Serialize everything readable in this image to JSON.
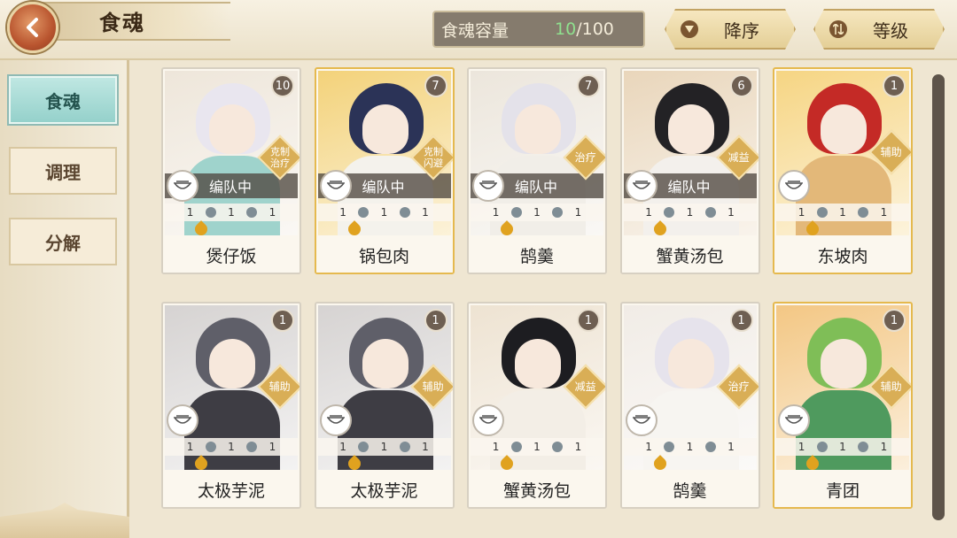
{
  "header": {
    "title": "食魂",
    "capacity_label": "食魂容量",
    "capacity_current": "10",
    "capacity_max": "/100",
    "sort_order_label": "降序",
    "sort_level_label": "等级"
  },
  "sidebar": {
    "tabs": [
      {
        "label": "食魂"
      },
      {
        "label": "调理"
      },
      {
        "label": "分解"
      }
    ]
  },
  "team_label": "编队中",
  "skill_value": "1",
  "cards": [
    {
      "name": "煲仔饭",
      "count": "10",
      "role": "克制\n治疗",
      "in_team": true
    },
    {
      "name": "锅包肉",
      "count": "7",
      "role": "克制\n闪避",
      "in_team": true
    },
    {
      "name": "鹄羹",
      "count": "7",
      "role": "治疗",
      "in_team": true
    },
    {
      "name": "蟹黄汤包",
      "count": "6",
      "role": "减益",
      "in_team": true
    },
    {
      "name": "东坡肉",
      "count": "1",
      "role": "辅助",
      "in_team": false
    },
    {
      "name": "太极芋泥",
      "count": "1",
      "role": "辅助",
      "in_team": false
    },
    {
      "name": "太极芋泥",
      "count": "1",
      "role": "辅助",
      "in_team": false
    },
    {
      "name": "蟹黄汤包",
      "count": "1",
      "role": "减益",
      "in_team": false
    },
    {
      "name": "鹄羹",
      "count": "1",
      "role": "治疗",
      "in_team": false
    },
    {
      "name": "青团",
      "count": "1",
      "role": "辅助",
      "in_team": false
    }
  ],
  "colors": {
    "active_tab": "#95d1cb",
    "role_badge": "#d9ae56",
    "card_gold_border": "#e5b94e",
    "capacity_value": "#8fe08e"
  },
  "icons": {
    "back": "back-arrow-icon",
    "sort_order": "triangle-down-icon",
    "sort_level": "sort-arrows-icon",
    "team": "bowl-icon",
    "skill": "skill-orb-icon",
    "star": "flame-icon"
  }
}
